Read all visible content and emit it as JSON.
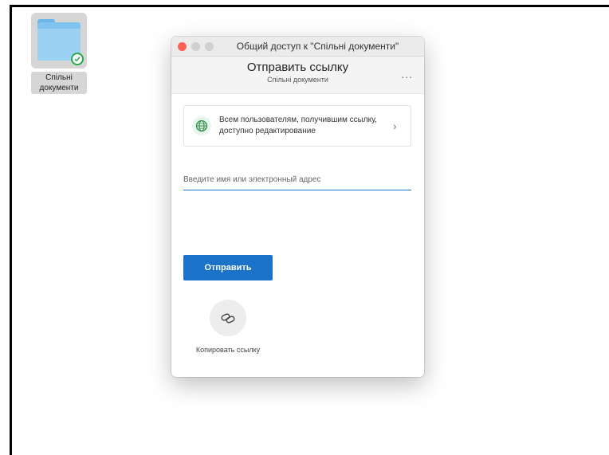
{
  "desktop": {
    "folder_label": "Спільні документи"
  },
  "dialog": {
    "window_title": "Общий доступ к \"Спільні документи\"",
    "header_title": "Отправить ссылку",
    "header_subtitle": "Спільні документи",
    "more_label": "...",
    "permission_text": "Всем пользователям, получившим ссылку, доступно редактирование",
    "recipient_placeholder": "Введите имя или электронный адрес",
    "send_label": "Отправить",
    "copy_link_label": "Копировать ссылку"
  },
  "colors": {
    "accent": "#1a73c8",
    "folder": "#7fc3ee",
    "sync_badge": "#2aa84a",
    "close_button": "#ff5f57"
  }
}
